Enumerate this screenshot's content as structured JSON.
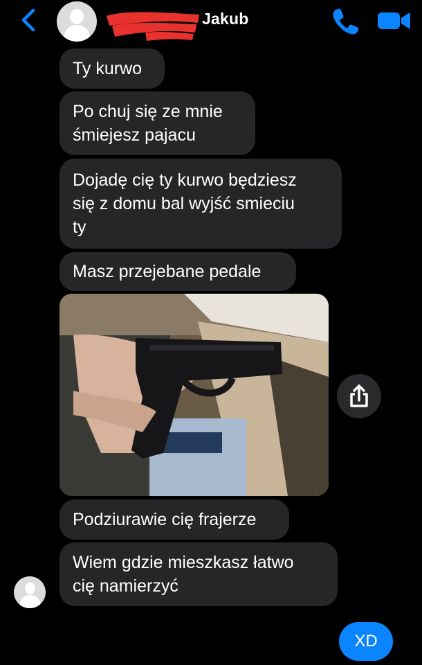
{
  "header": {
    "contact_name": "Jakub",
    "icons": [
      "back-chevron-icon",
      "avatar",
      "phone-icon",
      "video-camera-icon"
    ],
    "accent_color": "#0a84ff"
  },
  "messages": [
    {
      "from": "contact",
      "text": "Ty kurwo"
    },
    {
      "from": "contact",
      "text": "Po chuj się ze mnie\nśmiejesz pajacu"
    },
    {
      "from": "contact",
      "text": "Dojadę cię ty kurwo będziesz\nsię z domu bal wyjść smieciu\nty"
    },
    {
      "from": "contact",
      "text": "Masz przejebane pedale"
    },
    {
      "from": "contact",
      "type": "photo",
      "depicts": "hand-holding-pistol"
    },
    {
      "from": "contact",
      "text": "Podziurawie cię frajerze"
    },
    {
      "from": "contact",
      "text": "Wiem gdzie mieszkasz łatwo\ncię namierzyć"
    },
    {
      "from": "me",
      "text": "XD"
    }
  ],
  "colors": {
    "background": "#000000",
    "incoming_bubble": "#262629",
    "outgoing_bubble": "#0a84ff",
    "redaction": "#e8322e"
  }
}
